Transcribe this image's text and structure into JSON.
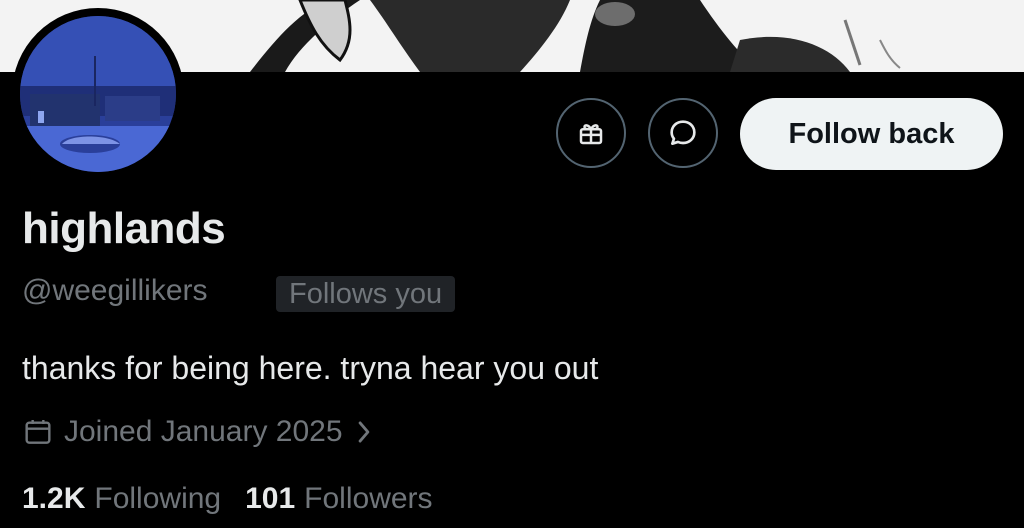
{
  "profile": {
    "display_name": "highlands",
    "handle": "@weegillikers",
    "follows_you_badge": "Follows you",
    "bio": "thanks for being here. tryna hear you out",
    "joined": "Joined January 2025",
    "following_count": "1.2K",
    "following_label": "Following",
    "followers_count": "101",
    "followers_label": "Followers"
  },
  "actions": {
    "follow_back_label": "Follow back",
    "gift_icon": "gift-icon",
    "message_icon": "message-icon"
  },
  "colors": {
    "background": "#000000",
    "primary_text": "#e7e9ea",
    "secondary_text": "#71767b",
    "button_bg": "#eff3f4",
    "button_text": "#0f1419",
    "icon_border": "#536471"
  }
}
